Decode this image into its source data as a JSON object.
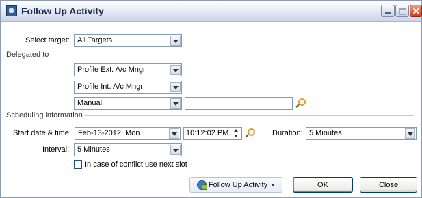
{
  "window": {
    "title": "Follow Up Activity"
  },
  "select_target": {
    "label": "Select target:",
    "value": "All Targets"
  },
  "delegated_to": {
    "heading": "Delegated to",
    "combos": [
      {
        "value": "Profile Ext. A/c Mngr"
      },
      {
        "value": "Profile Int. A/c Mngr"
      },
      {
        "value": "Manual"
      }
    ],
    "manual_input": ""
  },
  "scheduling": {
    "heading": "Scheduling information",
    "start_label": "Start date & time:",
    "start_date": "Feb-13-2012, Mon",
    "start_time": "10:12:02 PM",
    "duration_label": "Duration:",
    "duration_value": "5 Minutes",
    "interval_label": "Interval:",
    "interval_value": "5 Minutes",
    "conflict_label": "In case of conflict use next slot",
    "conflict_checked": false
  },
  "buttons": {
    "follow_up": "Follow Up Activity",
    "ok": "OK",
    "close": "Close"
  }
}
